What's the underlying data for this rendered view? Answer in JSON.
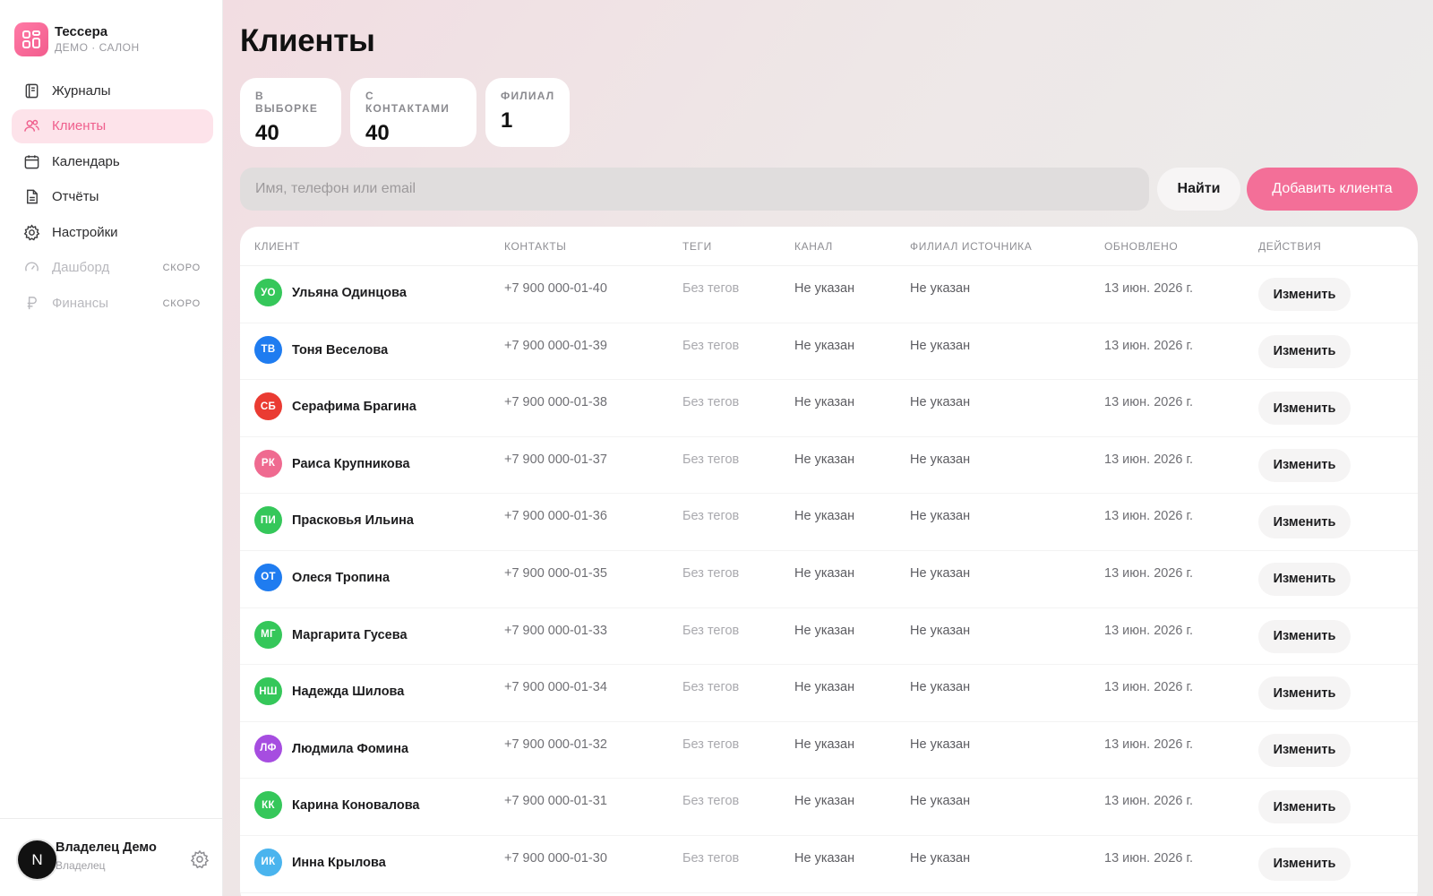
{
  "brand": {
    "name": "Тессера",
    "subtitle": "ДЕМО · САЛОН"
  },
  "sidebar": {
    "items": [
      {
        "label": "Журналы",
        "icon": "journal-icon",
        "state": "normal"
      },
      {
        "label": "Клиенты",
        "icon": "users-icon",
        "state": "active"
      },
      {
        "label": "Календарь",
        "icon": "calendar-icon",
        "state": "normal"
      },
      {
        "label": "Отчёты",
        "icon": "report-icon",
        "state": "normal"
      },
      {
        "label": "Настройки",
        "icon": "gear-icon",
        "state": "normal"
      },
      {
        "label": "Дашборд",
        "icon": "gauge-icon",
        "state": "disabled",
        "badge": "СКОРО"
      },
      {
        "label": "Финансы",
        "icon": "ruble-icon",
        "state": "disabled",
        "badge": "СКОРО"
      }
    ],
    "user": {
      "initial": "N",
      "name": "Владелец Демо",
      "role": "Владелец"
    }
  },
  "page": {
    "title": "Клиенты"
  },
  "stats": [
    {
      "label": "В ВЫБОРКЕ",
      "value": "40"
    },
    {
      "label": "С КОНТАКТАМИ",
      "value": "40"
    },
    {
      "label": "ФИЛИАЛ",
      "value": "1"
    }
  ],
  "search": {
    "placeholder": "Имя, телефон или email",
    "value": ""
  },
  "buttons": {
    "find": "Найти",
    "add": "Добавить клиента",
    "edit": "Изменить"
  },
  "table": {
    "headers": {
      "client": "КЛИЕНТ",
      "contacts": "КОНТАКТЫ",
      "tags": "ТЕГИ",
      "channel": "КАНАЛ",
      "branch": "ФИЛИАЛ ИСТОЧНИКА",
      "updated": "ОБНОВЛЕНО",
      "actions": "ДЕЙСТВИЯ"
    },
    "rows": [
      {
        "initials": "УО",
        "name": "Ульяна Одинцова",
        "phone": "+7 900 000-01-40",
        "tags": "Без тегов",
        "channel": "Не указан",
        "branch": "Не указан",
        "updated": "13 июн. 2026 г.",
        "color": "#35c75a"
      },
      {
        "initials": "ТВ",
        "name": "Тоня Веселова",
        "phone": "+7 900 000-01-39",
        "tags": "Без тегов",
        "channel": "Не указан",
        "branch": "Не указан",
        "updated": "13 июн. 2026 г.",
        "color": "#1f7cf0"
      },
      {
        "initials": "СБ",
        "name": "Серафима Брагина",
        "phone": "+7 900 000-01-38",
        "tags": "Без тегов",
        "channel": "Не указан",
        "branch": "Не указан",
        "updated": "13 июн. 2026 г.",
        "color": "#ea3b32"
      },
      {
        "initials": "РК",
        "name": "Раиса Крупникова",
        "phone": "+7 900 000-01-37",
        "tags": "Без тегов",
        "channel": "Не указан",
        "branch": "Не указан",
        "updated": "13 июн. 2026 г.",
        "color": "#ef6a90"
      },
      {
        "initials": "ПИ",
        "name": "Прасковья Ильина",
        "phone": "+7 900 000-01-36",
        "tags": "Без тегов",
        "channel": "Не указан",
        "branch": "Не указан",
        "updated": "13 июн. 2026 г.",
        "color": "#35c75a"
      },
      {
        "initials": "ОТ",
        "name": "Олеся Тропина",
        "phone": "+7 900 000-01-35",
        "tags": "Без тегов",
        "channel": "Не указан",
        "branch": "Не указан",
        "updated": "13 июн. 2026 г.",
        "color": "#1f7cf0"
      },
      {
        "initials": "МГ",
        "name": "Маргарита Гусева",
        "phone": "+7 900 000-01-33",
        "tags": "Без тегов",
        "channel": "Не указан",
        "branch": "Не указан",
        "updated": "13 июн. 2026 г.",
        "color": "#35c75a"
      },
      {
        "initials": "НШ",
        "name": "Надежда Шилова",
        "phone": "+7 900 000-01-34",
        "tags": "Без тегов",
        "channel": "Не указан",
        "branch": "Не указан",
        "updated": "13 июн. 2026 г.",
        "color": "#35c75a"
      },
      {
        "initials": "ЛФ",
        "name": "Людмила Фомина",
        "phone": "+7 900 000-01-32",
        "tags": "Без тегов",
        "channel": "Не указан",
        "branch": "Не указан",
        "updated": "13 июн. 2026 г.",
        "color": "#a64de0"
      },
      {
        "initials": "КК",
        "name": "Карина Коновалова",
        "phone": "+7 900 000-01-31",
        "tags": "Без тегов",
        "channel": "Не указан",
        "branch": "Не указан",
        "updated": "13 июн. 2026 г.",
        "color": "#35c75a"
      },
      {
        "initials": "ИК",
        "name": "Инна Крылова",
        "phone": "+7 900 000-01-30",
        "tags": "Без тегов",
        "channel": "Не указан",
        "branch": "Не указан",
        "updated": "13 июн. 2026 г.",
        "color": "#4ab4ee"
      }
    ]
  },
  "colors": {
    "accent": "#f36f98",
    "active_bg": "#fde3ea"
  }
}
